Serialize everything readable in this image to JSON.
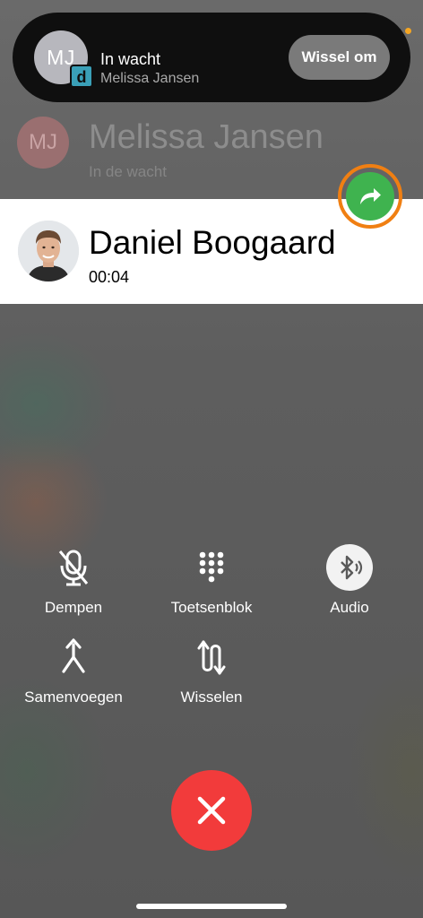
{
  "island": {
    "avatar_initials": "MJ",
    "badge_letter": "d",
    "title": "In wacht",
    "subtitle": "Melissa Jansen",
    "swap_button": "Wissel om"
  },
  "held_call": {
    "initials": "MJ",
    "name": "Melissa Jansen",
    "status": "In de wacht"
  },
  "active_call": {
    "name": "Daniel Boogaard",
    "timer": "00:04"
  },
  "controls": {
    "mute": "Dempen",
    "keypad": "Toetsenblok",
    "audio": "Audio",
    "merge": "Samenvoegen",
    "swap": "Wisselen"
  },
  "colors": {
    "forward_green": "#3fb34f",
    "highlight_orange": "#f07f12",
    "hangup_red": "#f23b3b"
  }
}
